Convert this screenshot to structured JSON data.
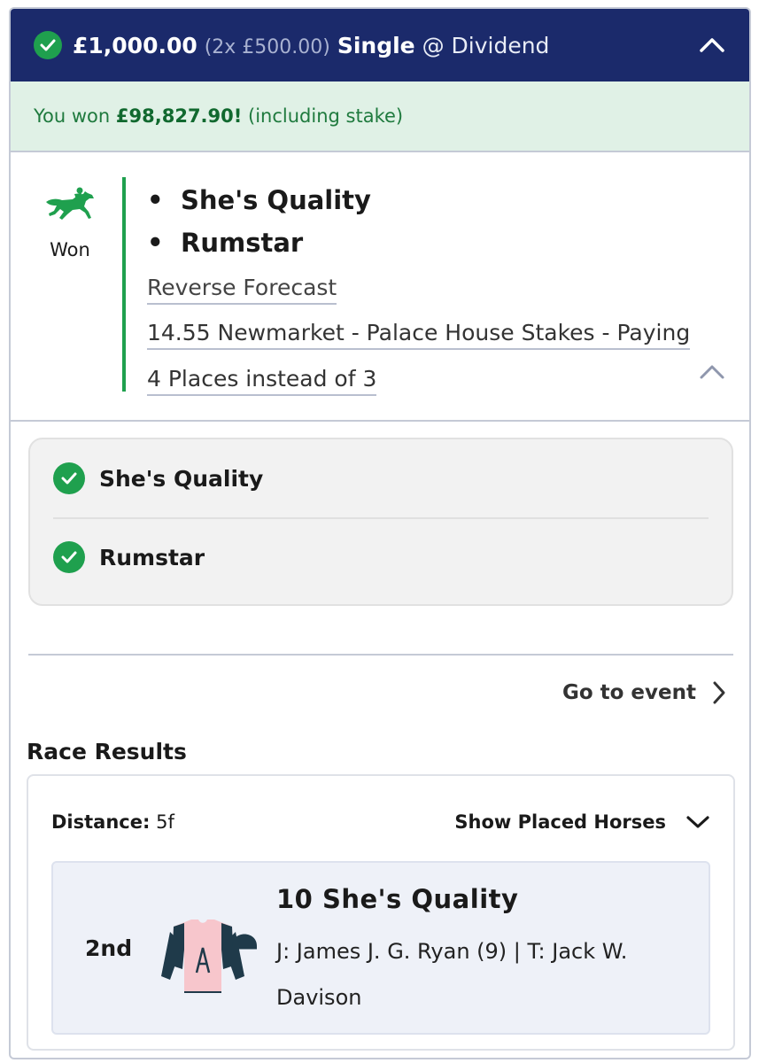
{
  "header": {
    "stake": "£1,000.00",
    "stake_breakdown": "(2x £500.00)",
    "bet_type": "Single",
    "odds": "@ Dividend",
    "icons": {
      "status": "check-icon",
      "collapse": "chevron-up-icon"
    }
  },
  "result_banner": {
    "prefix": "You won",
    "amount": "£98,827.90!",
    "suffix": "(including stake)"
  },
  "selection": {
    "status": "Won",
    "status_icon": "horse-racing-icon",
    "runners": [
      "She's Quality",
      "Rumstar"
    ],
    "market": "Reverse Forecast",
    "event_line1": "14.55 Newmarket - Palace House Stakes - Paying",
    "event_line2": "4 Places instead of 3"
  },
  "legs": [
    {
      "name": "She's Quality",
      "status": "won"
    },
    {
      "name": "Rumstar",
      "status": "won"
    }
  ],
  "go_to_event": "Go to event",
  "race_results": {
    "title": "Race Results",
    "distance_label": "Distance:",
    "distance_value": "5f",
    "show_placed": "Show Placed Horses",
    "runner": {
      "position": "2nd",
      "name": "10 She's Quality",
      "details": "J: James J. G. Ryan (9) | T: Jack W. Davison"
    }
  },
  "colors": {
    "header_bg": "#1b2a6b",
    "success_green": "#1fa04e",
    "won_banner_bg": "#e0f1e6"
  }
}
